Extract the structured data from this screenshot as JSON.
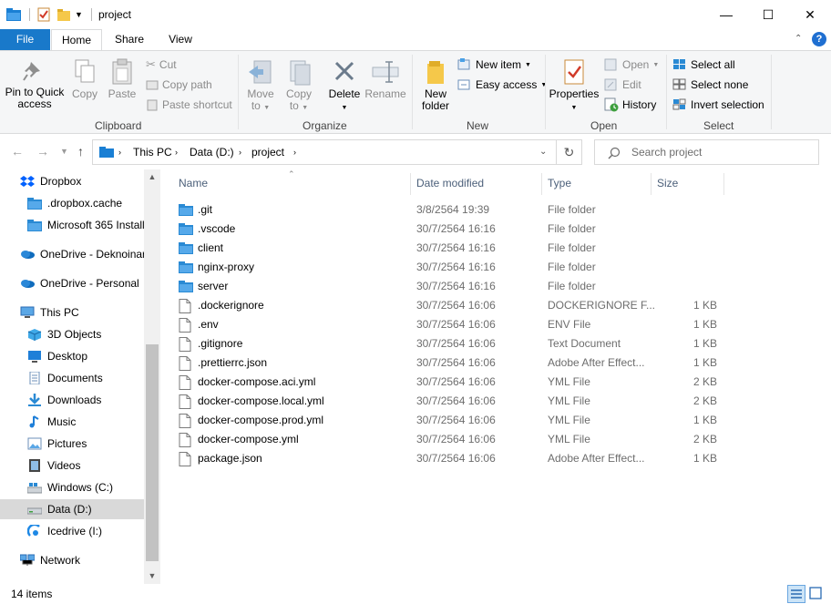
{
  "window": {
    "title": "project",
    "minimize": "—",
    "maximize": "☐",
    "close": "✕"
  },
  "ribbon_tabs": [
    "File",
    "Home",
    "Share",
    "View"
  ],
  "ribbon": {
    "clipboard": {
      "label": "Clipboard",
      "pin_line1": "Pin to Quick",
      "pin_line2": "access",
      "copy": "Copy",
      "paste": "Paste",
      "cut": "Cut",
      "copy_path": "Copy path",
      "paste_shortcut": "Paste shortcut"
    },
    "organize": {
      "label": "Organize",
      "move_line1": "Move",
      "move_line2": "to",
      "copy_line1": "Copy",
      "copy_line2": "to",
      "delete": "Delete",
      "rename": "Rename"
    },
    "new": {
      "label": "New",
      "new_folder_line1": "New",
      "new_folder_line2": "folder",
      "new_item": "New item",
      "easy_access": "Easy access"
    },
    "open": {
      "label": "Open",
      "properties": "Properties",
      "open": "Open",
      "edit": "Edit",
      "history": "History"
    },
    "select": {
      "label": "Select",
      "select_all": "Select all",
      "select_none": "Select none",
      "invert_selection": "Invert selection"
    }
  },
  "address": {
    "crumbs": [
      "This PC",
      "Data (D:)",
      "project"
    ],
    "search_placeholder": "Search project"
  },
  "nav_items": [
    {
      "label": "Dropbox",
      "icon": "dropbox-icon"
    },
    {
      "label": ".dropbox.cache",
      "icon": "folder-icon"
    },
    {
      "label": "Microsoft 365 Install",
      "icon": "folder-icon"
    },
    {
      "label": "OneDrive - Deknoinar",
      "icon": "onedrive-icon"
    },
    {
      "label": "OneDrive - Personal",
      "icon": "onedrive-icon"
    },
    {
      "label": "This PC",
      "icon": "computer-icon"
    },
    {
      "label": "3D Objects",
      "icon": "3d-objects-icon"
    },
    {
      "label": "Desktop",
      "icon": "desktop-icon"
    },
    {
      "label": "Documents",
      "icon": "documents-icon"
    },
    {
      "label": "Downloads",
      "icon": "downloads-icon"
    },
    {
      "label": "Music",
      "icon": "music-icon"
    },
    {
      "label": "Pictures",
      "icon": "pictures-icon"
    },
    {
      "label": "Videos",
      "icon": "videos-icon"
    },
    {
      "label": "Windows (C:)",
      "icon": "drive-windows-icon"
    },
    {
      "label": "Data (D:)",
      "icon": "drive-icon"
    },
    {
      "label": "Icedrive (I:)",
      "icon": "icedrive-icon"
    },
    {
      "label": "Network",
      "icon": "network-icon"
    }
  ],
  "columns": {
    "name": "Name",
    "date": "Date modified",
    "type": "Type",
    "size": "Size"
  },
  "files": [
    {
      "name": ".git",
      "date": "3/8/2564 19:39",
      "type": "File folder",
      "size": "",
      "kind": "folder"
    },
    {
      "name": ".vscode",
      "date": "30/7/2564 16:16",
      "type": "File folder",
      "size": "",
      "kind": "folder"
    },
    {
      "name": "client",
      "date": "30/7/2564 16:16",
      "type": "File folder",
      "size": "",
      "kind": "folder"
    },
    {
      "name": "nginx-proxy",
      "date": "30/7/2564 16:16",
      "type": "File folder",
      "size": "",
      "kind": "folder"
    },
    {
      "name": "server",
      "date": "30/7/2564 16:16",
      "type": "File folder",
      "size": "",
      "kind": "folder"
    },
    {
      "name": ".dockerignore",
      "date": "30/7/2564 16:06",
      "type": "DOCKERIGNORE F...",
      "size": "1 KB",
      "kind": "file"
    },
    {
      "name": ".env",
      "date": "30/7/2564 16:06",
      "type": "ENV File",
      "size": "1 KB",
      "kind": "file"
    },
    {
      "name": ".gitignore",
      "date": "30/7/2564 16:06",
      "type": "Text Document",
      "size": "1 KB",
      "kind": "file"
    },
    {
      "name": ".prettierrc.json",
      "date": "30/7/2564 16:06",
      "type": "Adobe After Effect...",
      "size": "1 KB",
      "kind": "file"
    },
    {
      "name": "docker-compose.aci.yml",
      "date": "30/7/2564 16:06",
      "type": "YML File",
      "size": "2 KB",
      "kind": "file"
    },
    {
      "name": "docker-compose.local.yml",
      "date": "30/7/2564 16:06",
      "type": "YML File",
      "size": "2 KB",
      "kind": "file"
    },
    {
      "name": "docker-compose.prod.yml",
      "date": "30/7/2564 16:06",
      "type": "YML File",
      "size": "1 KB",
      "kind": "file"
    },
    {
      "name": "docker-compose.yml",
      "date": "30/7/2564 16:06",
      "type": "YML File",
      "size": "2 KB",
      "kind": "file"
    },
    {
      "name": "package.json",
      "date": "30/7/2564 16:06",
      "type": "Adobe After Effect...",
      "size": "1 KB",
      "kind": "file"
    }
  ],
  "status": {
    "count": "14 items"
  },
  "colors": {
    "file_tab": "#1979ca",
    "folder": "#2a8ad4",
    "selection": "#d9d9d9"
  }
}
